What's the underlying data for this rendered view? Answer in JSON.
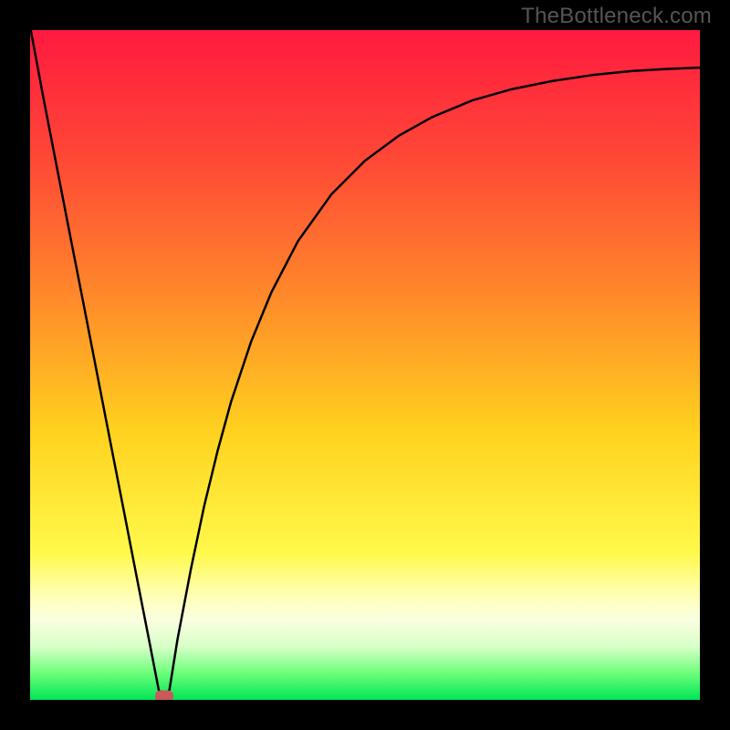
{
  "watermark": "TheBottleneck.com",
  "chart_data": {
    "type": "line",
    "title": "",
    "xlabel": "",
    "ylabel": "",
    "ylim": [
      0,
      1
    ],
    "x": [
      0.0,
      0.02,
      0.04,
      0.06,
      0.08,
      0.1,
      0.12,
      0.14,
      0.16,
      0.18,
      0.192,
      0.2,
      0.208,
      0.22,
      0.24,
      0.26,
      0.28,
      0.3,
      0.33,
      0.36,
      0.4,
      0.45,
      0.5,
      0.55,
      0.6,
      0.66,
      0.72,
      0.78,
      0.84,
      0.9,
      0.95,
      1.0
    ],
    "values": [
      1.0,
      0.898,
      0.795,
      0.692,
      0.59,
      0.487,
      0.384,
      0.282,
      0.179,
      0.077,
      0.015,
      0.0,
      0.015,
      0.09,
      0.195,
      0.29,
      0.372,
      0.445,
      0.535,
      0.608,
      0.685,
      0.755,
      0.805,
      0.842,
      0.87,
      0.895,
      0.912,
      0.924,
      0.933,
      0.939,
      0.942,
      0.944
    ],
    "optimum_x": 0.2,
    "optimum_y": 0.0
  }
}
